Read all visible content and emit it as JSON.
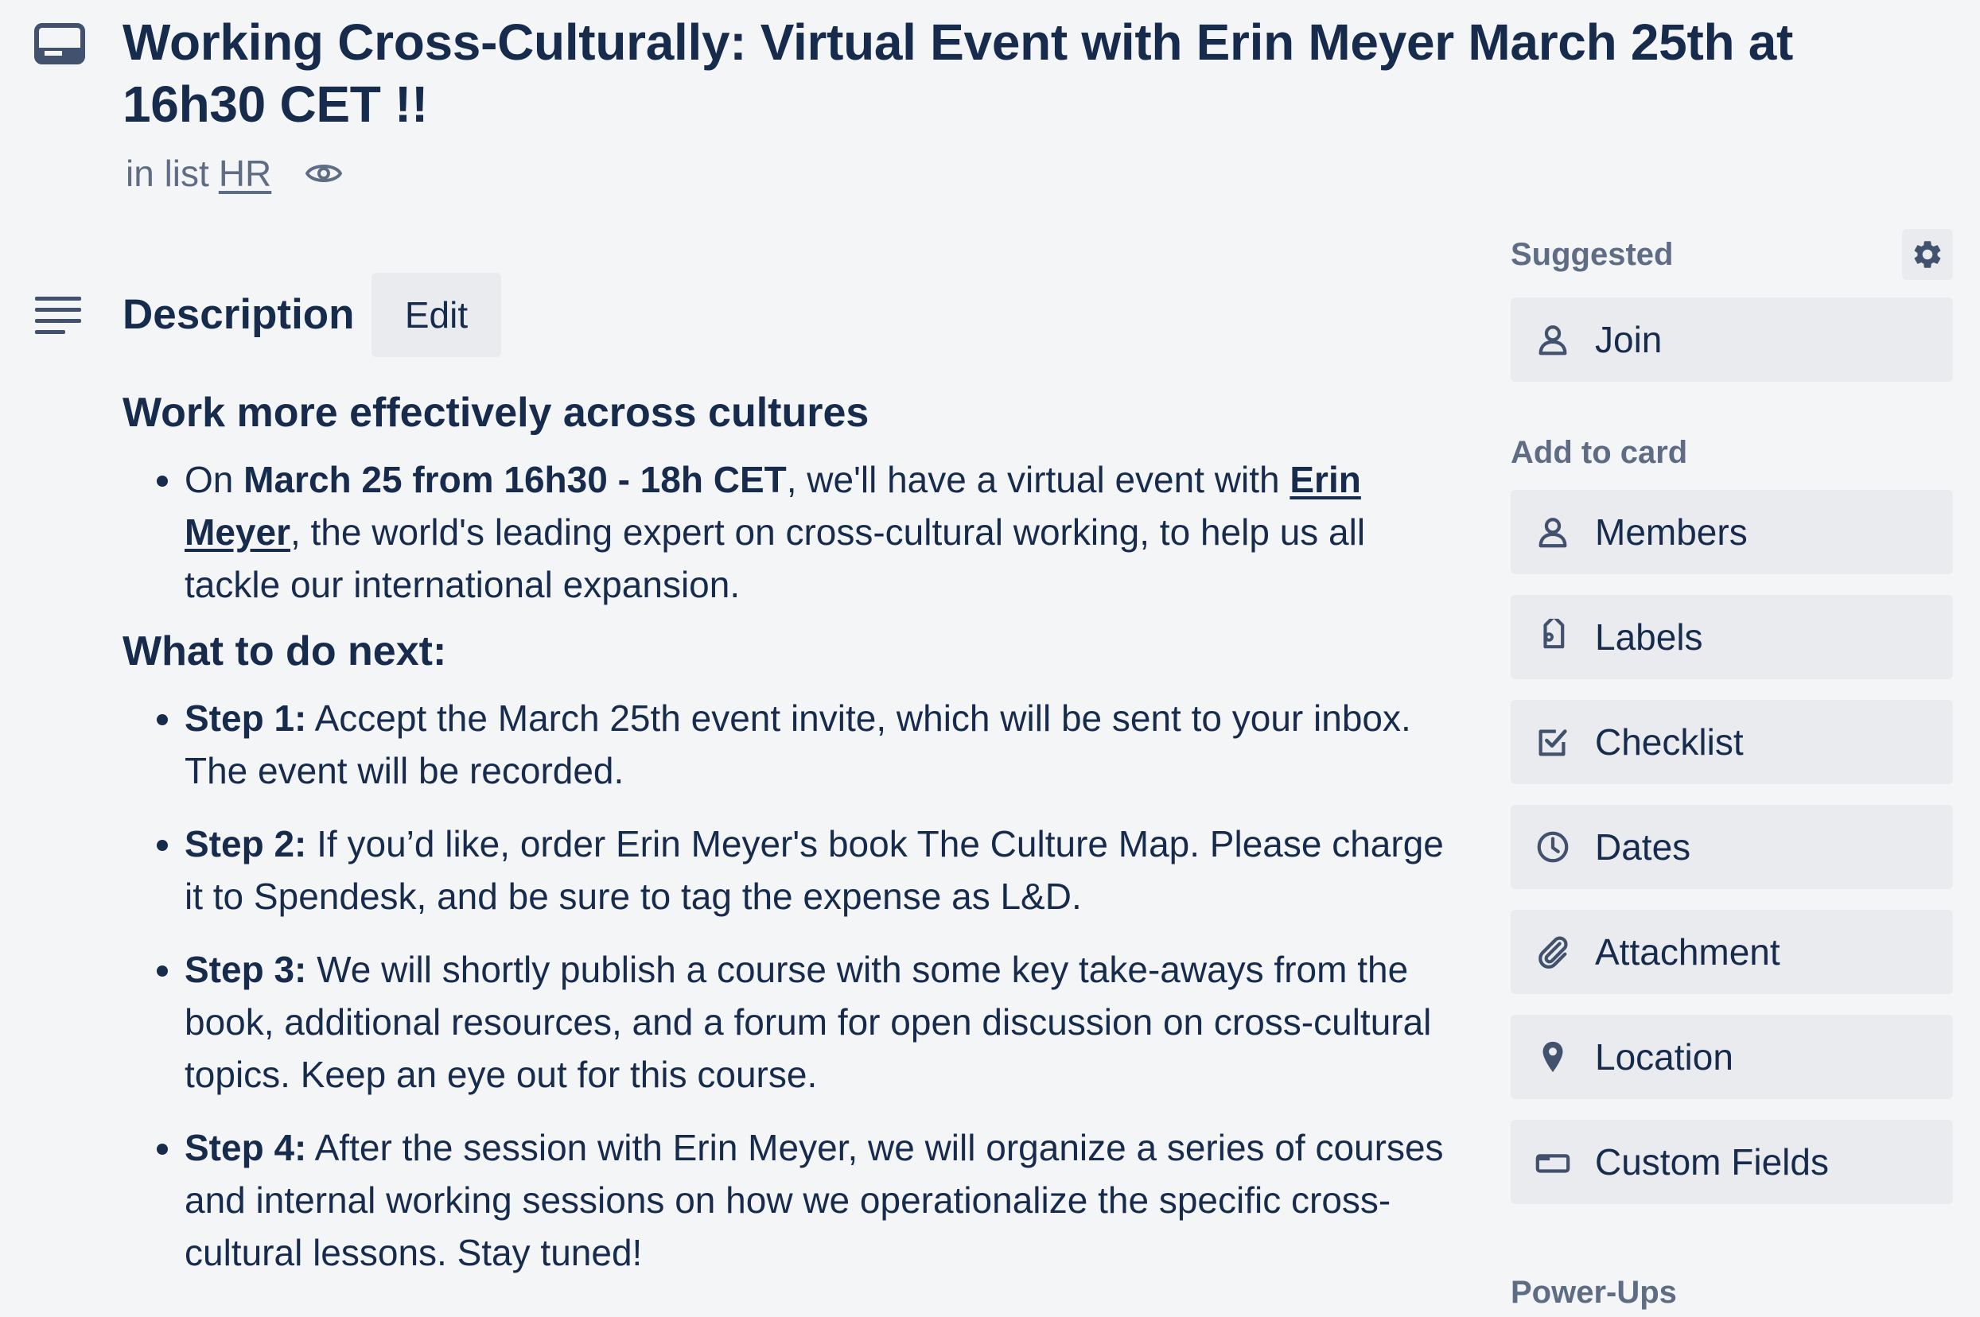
{
  "card": {
    "title": "Working Cross-Culturally: Virtual Event with Erin Meyer March 25th at 16h30 CET !!",
    "in_list_prefix": "in list",
    "list_name": "HR"
  },
  "description": {
    "heading": "Description",
    "edit_label": "Edit",
    "h1": "Work more effectively across cultures",
    "intro": {
      "part1": "On ",
      "bold": "March 25 from 16h30 - 18h CET",
      "part2": ", we'll have a virtual event with ",
      "link": "Erin Meyer",
      "part3": ", the world's leading expert on cross-cultural working, to help us all tackle our international expansion."
    },
    "h2": "What to do next:",
    "steps": [
      {
        "label": "Step 1:",
        "text": " Accept the March 25th event invite, which will be sent to your inbox. The event will be recorded."
      },
      {
        "label": "Step 2:",
        "text": " If you’d like, order Erin Meyer's book The Culture Map. Please charge it to Spendesk, and be sure to tag the expense as L&D."
      },
      {
        "label": "Step 3:",
        "text": " We will shortly publish a course with some key take-aways from the book, additional resources, and a forum for open discussion on cross-cultural topics. Keep an eye out for this course."
      },
      {
        "label": "Step 4:",
        "text": " After the session with Erin Meyer, we will organize a series of courses and internal working sessions on how we operationalize the specific cross-cultural lessons. Stay tuned!"
      }
    ]
  },
  "sidebar": {
    "suggested_heading": "Suggested",
    "join_label": "Join",
    "add_to_card_heading": "Add to card",
    "buttons": [
      {
        "label": "Members",
        "icon": "person-icon"
      },
      {
        "label": "Labels",
        "icon": "tag-icon"
      },
      {
        "label": "Checklist",
        "icon": "checkbox-icon"
      },
      {
        "label": "Dates",
        "icon": "clock-icon"
      },
      {
        "label": "Attachment",
        "icon": "paperclip-icon"
      },
      {
        "label": "Location",
        "icon": "location-pin-icon"
      },
      {
        "label": "Custom Fields",
        "icon": "custom-fields-icon"
      }
    ],
    "power_ups_heading": "Power-Ups"
  },
  "colors": {
    "background": "#f4f5f7",
    "text": "#172b4d",
    "muted": "#5e6c84",
    "button_bg": "#e9ebee"
  }
}
